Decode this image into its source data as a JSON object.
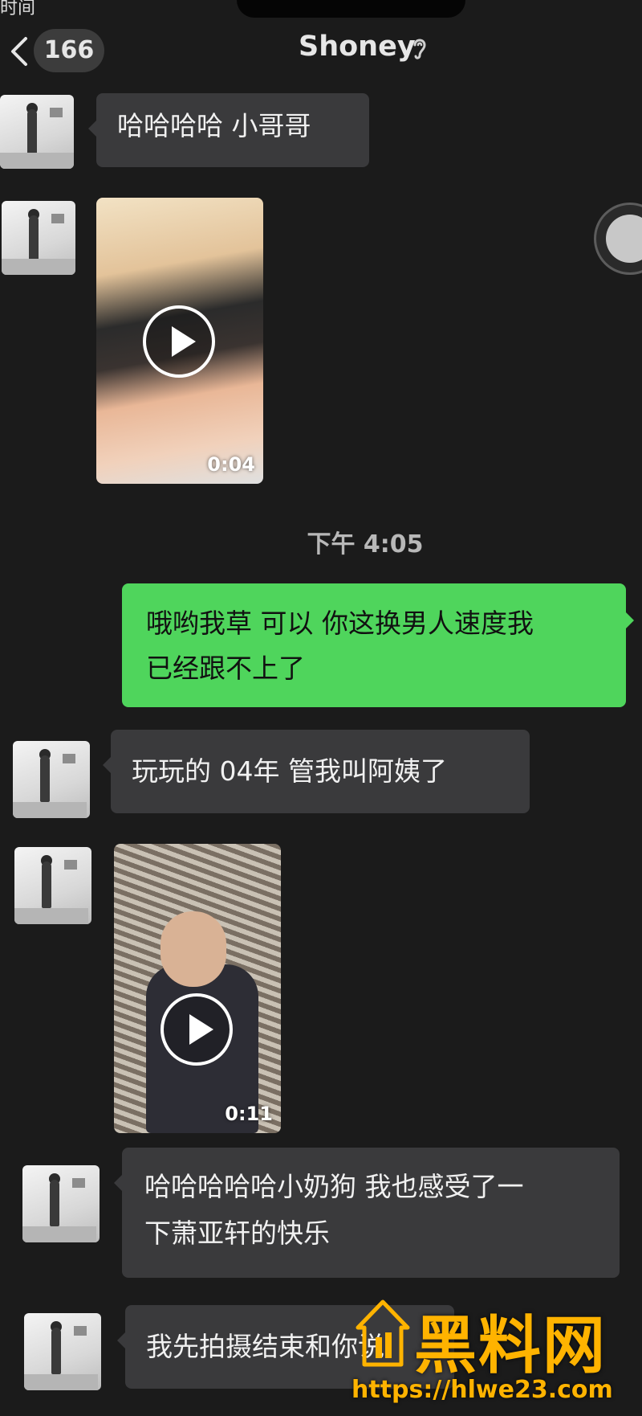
{
  "status_fragment": "时间",
  "header": {
    "unread_count": "166",
    "title": "Shoney"
  },
  "messages": {
    "m1": "哈哈哈哈 小哥哥",
    "v1_duration": "0:04",
    "timestamp": "下午 4:05",
    "m2_line1": "哦哟我草 可以 你这换男人速度我",
    "m2_line2": "已经跟不上了",
    "m3": "玩玩的 04年 管我叫阿姨了",
    "v2_duration": "0:11",
    "m4_line1": "哈哈哈哈哈小奶狗 我也感受了一",
    "m4_line2": "下萧亚轩的快乐",
    "m5": "我先拍摄结束和你说"
  },
  "watermark": {
    "title": "黑料网",
    "url": "https://hlwe23.com"
  },
  "icons": {
    "back": "chevron-left-icon",
    "ear": "ear-icon",
    "play": "play-icon"
  },
  "colors": {
    "background": "#1b1b1b",
    "incoming_bubble": "#3a3a3c",
    "outgoing_bubble": "#4fd55c",
    "watermark": "#ffb300"
  }
}
